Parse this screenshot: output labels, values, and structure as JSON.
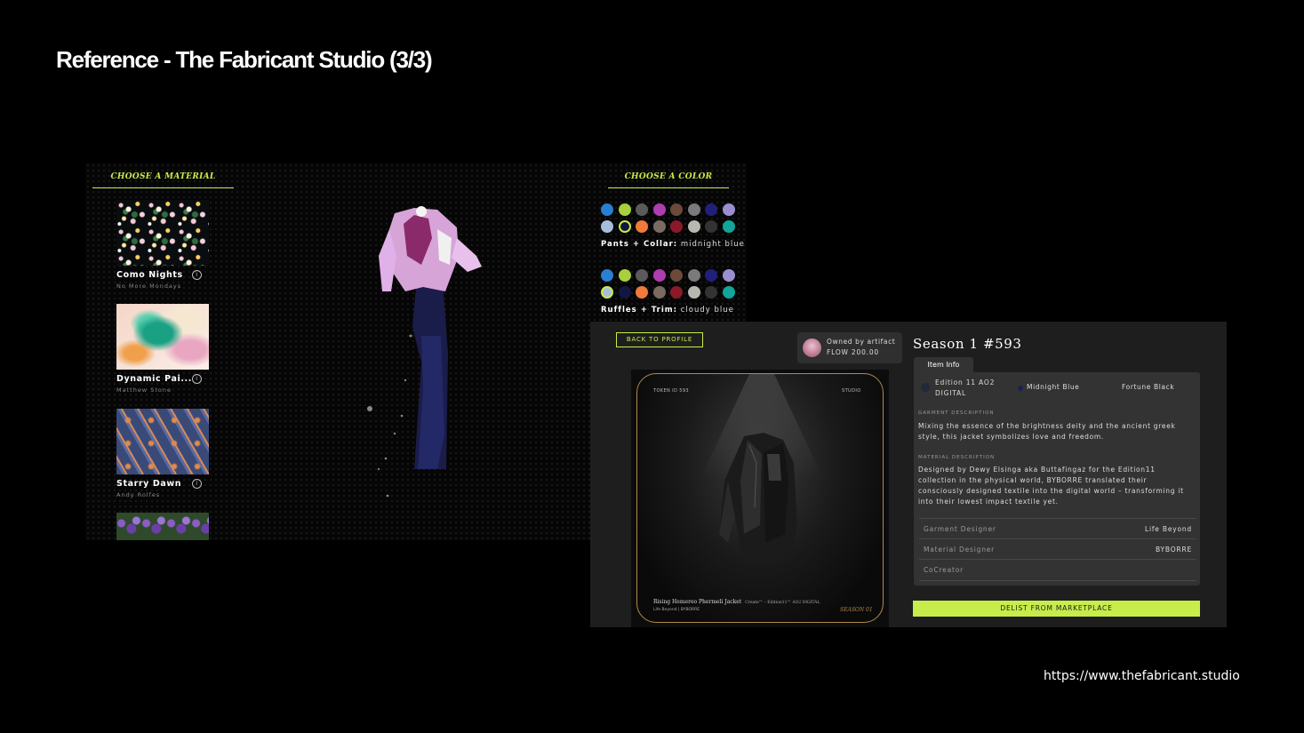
{
  "slide": {
    "title": "Reference - The Fabricant Studio (3/3)",
    "url": "https://www.thefabricant.studio"
  },
  "editor": {
    "material_heading": "CHOOSE A MATERIAL",
    "color_heading": "CHOOSE A COLOR",
    "materials": [
      {
        "name": "Como Nights",
        "author": "No More Mondays"
      },
      {
        "name": "Dynamic Pai...",
        "author": "Matthew Stone"
      },
      {
        "name": "Starry Dawn",
        "author": "Andy Rolfes"
      },
      {
        "name": "",
        "author": ""
      }
    ],
    "color_groups": [
      {
        "part": "Pants + Collar:",
        "value": "midnight blue",
        "selected_index": 9
      },
      {
        "part": "Ruffles + Trim:",
        "value": "cloudy blue",
        "selected_index": 8
      }
    ],
    "palette": [
      "#2a7fd1",
      "#a8cf3c",
      "#5a5a5a",
      "#b03db0",
      "#6b4a3a",
      "#7a7a7a",
      "#20207a",
      "#9c8fd0",
      "#a7bddc",
      "#121640",
      "#f07a3a",
      "#7a6a60",
      "#8a1a2a",
      "#b8b8b0",
      "#333333",
      "#12a59a"
    ],
    "info_icon": "info-icon"
  },
  "detail": {
    "back_button": "BACK TO PROFILE",
    "owner_line1": "Owned by artifact",
    "owner_line2": "FLOW 200.00",
    "nft": {
      "token": "TOKEN ID 593",
      "studio": "STUDIO",
      "name": "Rising Hemereo Phermeli Jacket",
      "name_sub": "Create™ – Edition11™ AO2 DIGITAL",
      "by": "Life Beyond | BYBORRE",
      "season": "SEASON 01"
    },
    "title": "Season 1 #593",
    "tab": "Item Info",
    "edition_line1": "Edition 11 AO2",
    "edition_line2": "DIGITAL",
    "color_primary": "Midnight Blue",
    "color_secondary": "Fortune Black",
    "garment_label": "GARMENT DESCRIPTION",
    "garment_desc": "Mixing the essence of the brightness deity and the ancient greek style, this jacket symbolizes love and freedom.",
    "material_label": "MATERIAL DESCRIPTION",
    "material_desc": "Designed by Dewy Elsinga aka Buttafingaz for the Edition11  collection in the physical world, BYBORRE translated their consciously designed textile into the digital world – transforming it into their lowest impact textile yet.",
    "rows": [
      {
        "key": "Garment Designer",
        "value": "Life Beyond"
      },
      {
        "key": "Material Designer",
        "value": "BYBORRE"
      },
      {
        "key": "CoCreator",
        "value": ""
      }
    ],
    "delist_button": "DELIST FROM MARKETPLACE"
  }
}
